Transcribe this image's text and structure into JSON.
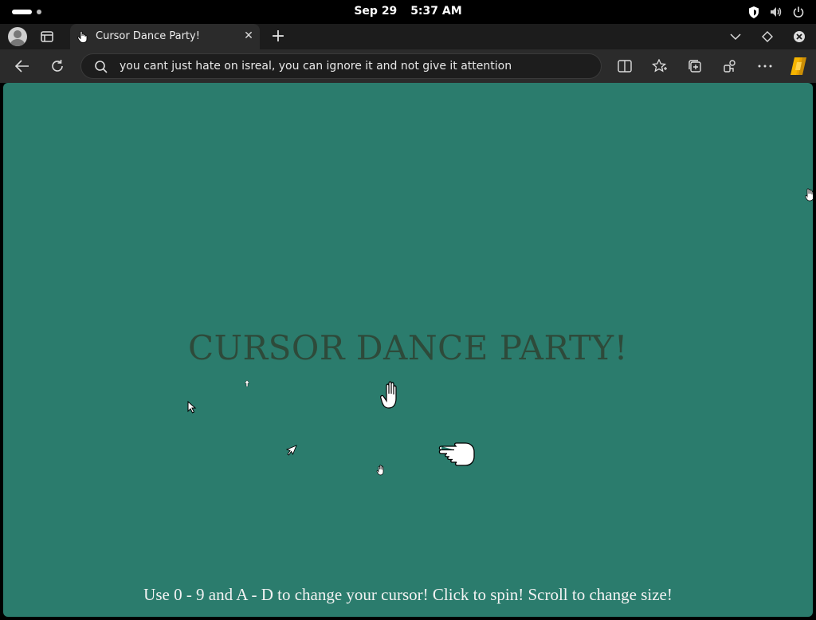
{
  "os": {
    "date": "Sep 29",
    "time": "5:37 AM"
  },
  "tab": {
    "title": "Cursor Dance Party!"
  },
  "addressbar": {
    "text": "you cant just hate on isreal, you can ignore it and not give it attention"
  },
  "page": {
    "heading": "CURSOR DANCE PARTY!",
    "instructions": "Use 0 - 9 and A - D to change your cursor! Click to spin! Scroll to change size!",
    "background": "#2b7c6d",
    "heading_color": "#2e4a3a"
  },
  "colors": {
    "browser_bg": "#2b2b2b",
    "tabstrip_bg": "#1c1c1c",
    "copilot_accent": "#f5b400"
  }
}
